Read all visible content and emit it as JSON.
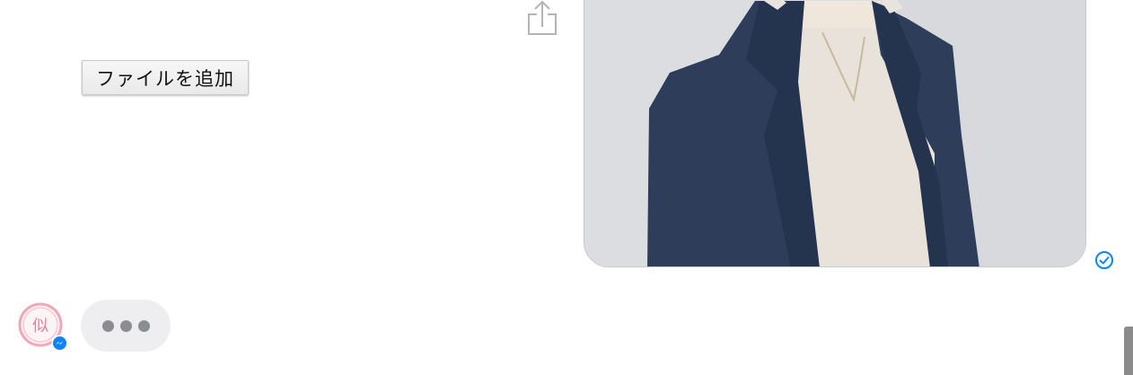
{
  "conversation": {
    "add_file_label": "ファイルを追加",
    "photo_icon": "photo-of-person-in-navy-blazer",
    "share_icon": "share-upload-icon",
    "read_receipt_icon": "check-circle-icon",
    "avatar_glyph": "似",
    "avatar_badge_icon": "messenger-icon",
    "typing_indicator_icon": "ellipsis-icon"
  },
  "colors": {
    "accent": "#0a84ff",
    "typing_bubble": "#eeeef0",
    "typing_dots": "#8a8d92",
    "avatar_ring": "#f2a7b8",
    "blazer": "#2d3d5a",
    "blouse": "#e8e2da",
    "photo_background": "#dcdde1"
  }
}
